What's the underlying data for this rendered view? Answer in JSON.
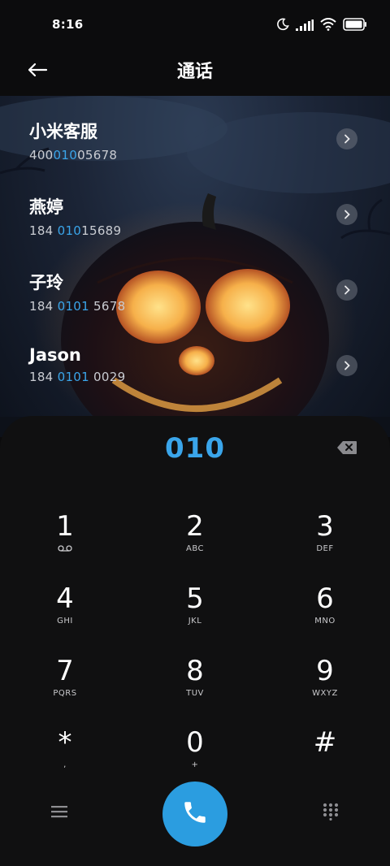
{
  "status_bar": {
    "time": "8:16",
    "icons": [
      "moon-icon",
      "signal-icon",
      "wifi-icon",
      "battery-icon"
    ]
  },
  "header": {
    "title": "通话",
    "back_icon": "back-arrow-icon"
  },
  "contacts": [
    {
      "name": "小米客服",
      "number_pre": "400",
      "number_hl": "010",
      "number_post": "05678"
    },
    {
      "name": "燕婷",
      "number_pre": "184 ",
      "number_hl": "010",
      "number_post": "15689"
    },
    {
      "name": "子玲",
      "number_pre": "184 ",
      "number_hl": "0101",
      "number_post": " 5678"
    },
    {
      "name": "Jason",
      "number_pre": "184 ",
      "number_hl": "0101",
      "number_post": " 0029"
    }
  ],
  "dialpad": {
    "entered_number": "010",
    "keys": [
      {
        "digit": "1",
        "letters": ""
      },
      {
        "digit": "2",
        "letters": "ABC"
      },
      {
        "digit": "3",
        "letters": "DEF"
      },
      {
        "digit": "4",
        "letters": "GHI"
      },
      {
        "digit": "5",
        "letters": "JKL"
      },
      {
        "digit": "6",
        "letters": "MNO"
      },
      {
        "digit": "7",
        "letters": "PQRS"
      },
      {
        "digit": "8",
        "letters": "TUV"
      },
      {
        "digit": "9",
        "letters": "WXYZ"
      },
      {
        "digit": "*",
        "letters": ","
      },
      {
        "digit": "0",
        "letters": "+"
      },
      {
        "digit": "#",
        "letters": ""
      }
    ]
  },
  "colors": {
    "accent": "#3aa5ea",
    "call_button": "#2b9de0",
    "sheet": "#101011"
  }
}
